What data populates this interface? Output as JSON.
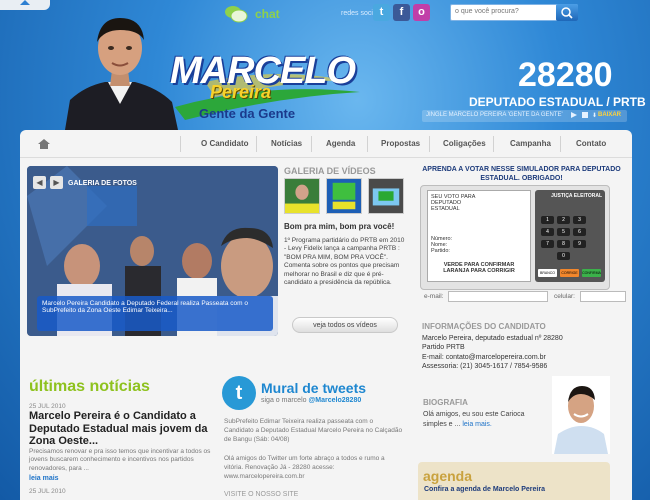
{
  "header": {
    "chat_label": "chat",
    "social_label": "redes sociais",
    "social": [
      {
        "icon": "twitter-icon",
        "glyph": "t",
        "color": "#4aa8e0"
      },
      {
        "icon": "facebook-icon",
        "glyph": "f",
        "color": "#3b5998"
      },
      {
        "icon": "orkut-icon",
        "glyph": "o",
        "color": "#c13fa8"
      }
    ],
    "search_placeholder": "o que você procura?",
    "number": "28280",
    "position": "DEPUTADO ESTADUAL / PRTB",
    "jingle_label": "JINGLE MARCELO PEREIRA 'GENTE DA GENTE'",
    "download_label": "BAIXAR"
  },
  "logo": {
    "name": "MARCELO",
    "surname": "Pereira",
    "slogan": "Gente da Gente"
  },
  "nav": {
    "items": [
      "O Candidato",
      "Notícias",
      "Agenda",
      "Propostas",
      "Coligações",
      "Campanha",
      "Contato"
    ]
  },
  "gallery": {
    "label": "GALERIA DE FOTOS",
    "caption": "Marcelo Pereira Candidato a Deputado Federal realiza Passeata com o SubPrefeito da Zona Oeste Edimar Teixeira..."
  },
  "videos": {
    "title": "GALERIA DE VÍDEOS",
    "headline": "Bom pra mim, bom pra você!",
    "text": "1º Programa partidário do PRTB em 2010 - Levy Fidelix lança a campanha PRTB : \"BOM PRA MIM, BOM PRA VOCÊ\". Comenta sobre os pontos que precisam melhorar no Brasil e diz que é pré-candidato a presidência da república.",
    "all_button": "veja todos os vídeos"
  },
  "simulator": {
    "heading": "APRENDA A VOTAR NESSE SIMULADOR PARA DEPUTADO ESTADUAL. OBRIGADO!",
    "screen_title": "SEU VOTO PARA DEPUTADO ESTADUAL",
    "number_label": "Número:",
    "name_label": "Nome:",
    "party_label": "Partido:",
    "instructions": "VERDE PARA CONFIRMAR LARANJA PARA CORRIGIR",
    "justica": "JUSTIÇA ELEITORAL",
    "keys": [
      "1",
      "2",
      "3",
      "4",
      "5",
      "6",
      "7",
      "8",
      "9",
      "0"
    ],
    "controls": [
      "BRANCO",
      "CORRIGE",
      "CONFIRMA"
    ],
    "email_label": "e-mail:",
    "phone_label": "celular:"
  },
  "candidate_info": {
    "title": "INFORMAÇÕES DO CANDIDATO",
    "lines": [
      "Marcelo Pereira, deputado estadual nº 28280",
      "Partido PRTB",
      "E-mail: contato@marcelopereira.com.br",
      "Assessoria: (21) 3045-1617 / 7854-9586"
    ]
  },
  "bio": {
    "title": "BIOGRAFIA",
    "text": "Olá amigos, eu sou este Carioca simples e ...",
    "link": "leia mais."
  },
  "agenda": {
    "title": "agenda",
    "sub": "Confira a agenda de Marcelo Pereira"
  },
  "news": {
    "title": "últimas notícias",
    "items": [
      {
        "date": "25 JUL 2010",
        "headline": "Marcelo Pereira é o Candidato a Deputado Estadual mais jovem da Zona Oeste...",
        "body": "Precisamos renovar e pra isso temos que incentivar a todos os jovens buscarem conhecimento e incentivos nos partidos renovadores, para ...",
        "link": "leia mais"
      },
      {
        "date": "25 JUL 2010",
        "headline": "",
        "body": "",
        "link": ""
      }
    ]
  },
  "tweets": {
    "title": "Mural de tweets",
    "sub_prefix": "siga o marcelo",
    "handle": "@Marcelo28280",
    "items": [
      "SubPrefeito Edimar Teixeira realiza passeata com o Candidato a Deputado Estadual Marcelo Pereira no Calçadão de Bangu (Sáb: 04/08)",
      "Olá amigos do Twitter um forte abraço a todos e rumo a vitória. Renovação Já - 28280 acesse: www.marcelopereira.com.br"
    ],
    "visit_label": "VISITE O NOSSO SITE"
  },
  "colors": {
    "background": "#2f88d6",
    "accent_green": "#8ec21e",
    "link_blue": "#1e73c8",
    "logo_yellow": "#f7d12a"
  }
}
